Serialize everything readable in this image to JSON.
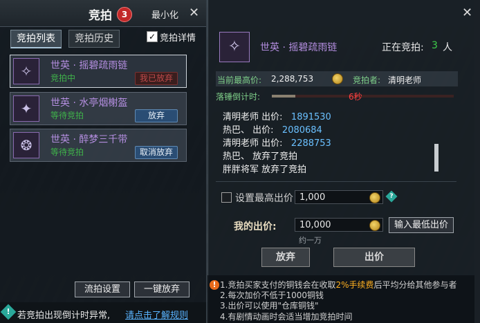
{
  "left": {
    "title": "竞拍",
    "badge": "3",
    "minimize": "最小化",
    "close": "✕",
    "tabs": [
      "竞拍列表",
      "竞拍历史"
    ],
    "detail_check": "✓",
    "detail_label": "竞拍详情",
    "items": [
      {
        "icon": "✧",
        "name": "世英 · 摇碧疏雨链",
        "status": "竞拍中",
        "button": "我已放弃"
      },
      {
        "icon": "✦",
        "name": "世英 · 水亭烟榭盔",
        "status": "等待竞拍",
        "button": "放弃"
      },
      {
        "icon": "❂",
        "name": "世英 · 醉梦三千带",
        "status": "等待竞拍",
        "button": "取消放弃"
      }
    ],
    "btn_pass_setting": "流拍设置",
    "btn_giveup_all": "一键放弃",
    "footer_icon": "!",
    "footer_text": "若竞拍出现倒计时异常,",
    "footer_link": "请点击了解规则"
  },
  "right": {
    "close": "✕",
    "item_icon": "✧",
    "item_name": "世英 · 摇碧疏雨链",
    "bidding_label": "正在竞拍:",
    "bidding_count": "3",
    "bidding_unit": "人",
    "current_high_label": "当前最高价:",
    "current_high_value": "2,288,753",
    "bidder_label": "竞拍者:",
    "bidder_name": "清明老师",
    "countdown_label": "落锤倒计时:",
    "countdown_secs": "6秒",
    "countdown_fraction": 0.13,
    "log": [
      {
        "who": "清明老师 出价:",
        "amount": "1891530"
      },
      {
        "who": "热巴、 出价:",
        "amount": "2080684"
      },
      {
        "who": "清明老师 出价:",
        "amount": "2288753"
      },
      {
        "who": "热巴、 放弃了竞拍",
        "amount": ""
      },
      {
        "who": "胖胖将军 放弃了竞拍",
        "amount": ""
      }
    ],
    "max_bid_label": "设置最高出价",
    "max_bid_value": "1,000",
    "info_icon": "?",
    "my_bid_label": "我的出价:",
    "my_bid_value": "10,000",
    "input_min_btn": "输入最低出价",
    "hint": "约一万",
    "btn_giveup": "放弃",
    "btn_bid": "出价",
    "notes_icon": "!",
    "notes": [
      {
        "pre": "1.竞拍买家支付的铜钱会在收取",
        "hl": "2%手续费",
        "post": "后平均分给其他参与者"
      },
      {
        "pre": "2.每次加价不低于1000铜钱",
        "hl": "",
        "post": ""
      },
      {
        "pre": "3.出价可以使用\"仓库铜钱\"",
        "hl": "",
        "post": ""
      },
      {
        "pre": "4.有剧情动画时会适当增加竞拍时间",
        "hl": "",
        "post": ""
      }
    ]
  }
}
